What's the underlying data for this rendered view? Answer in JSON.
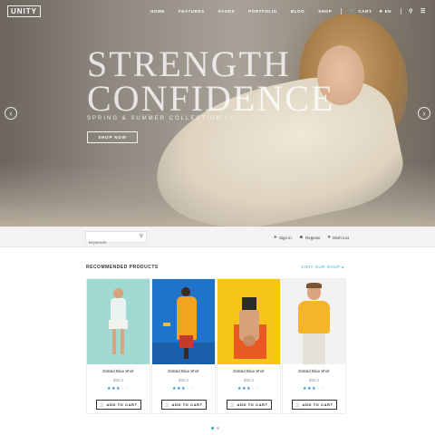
{
  "logo": "UNITY",
  "nav": {
    "items": [
      "HOME",
      "FEATURES",
      "PAGES",
      "PORTFOLIO",
      "BLOG",
      "SHOP"
    ],
    "cart": "CART",
    "language": "EN"
  },
  "hero": {
    "title_line1": "STRENGTH",
    "title_line2": "CONFIDENCE",
    "subtitle": "SPRING & SUMMER COLLECTION'15",
    "button": "SHOP NOW"
  },
  "account_bar": {
    "search_placeholder": "keywords",
    "sign_in": "Sign in",
    "register": "Register",
    "wish_list": "Wish List"
  },
  "products_section": {
    "title": "RECOMMENDED PRODUCTS",
    "link": "VISIT OUR SHOP ▸",
    "items": [
      {
        "name": "Dotted Blue Shirt",
        "price": "$50.0",
        "rating": 3,
        "button": "ADD TO CART"
      },
      {
        "name": "Dotted Blue Shirt",
        "price": "$50.0",
        "rating": 3,
        "button": "ADD TO CART"
      },
      {
        "name": "Dotted Blue Shirt",
        "price": "$50.0",
        "rating": 3,
        "button": "ADD TO CART"
      },
      {
        "name": "Dotted Blue Shirt",
        "price": "$50.0",
        "rating": 3,
        "button": "ADD TO CART"
      }
    ]
  },
  "colors": {
    "accent": "#2aa6d9",
    "star": "#2b7fd6",
    "card_bg_1": "#9fd9d2",
    "card_bg_2": "#1f74c9",
    "card_bg_3": "#f5c51a",
    "card_bg_4": "#f2f2f2"
  },
  "icons": {
    "hero_prev": "chevron-left-icon",
    "hero_next": "chevron-right-icon",
    "search": "search-icon",
    "menu": "menu-icon",
    "cart": "cart-icon",
    "sign_in": "sign-in-icon",
    "register": "user-icon",
    "wish_list": "heart-icon"
  },
  "carousel": {
    "pages": 2,
    "active": 1
  }
}
